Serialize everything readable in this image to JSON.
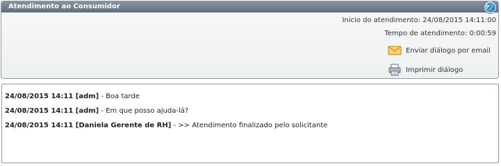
{
  "window": {
    "title": "Atendimento ao Consumidor",
    "globe_icon": "globe-icon"
  },
  "info": {
    "start_label": "Inicio do atendimento:",
    "start_value": "24/08/2015 14:11:00",
    "duration_label": "Tempo de atendimento:",
    "duration_value": "0:00:59"
  },
  "actions": {
    "email_label": "Enviar diálogo por email",
    "email_icon": "envelope-icon",
    "print_label": "Imprimir diálogo",
    "print_icon": "printer-icon"
  },
  "messages": [
    {
      "header": "24/08/2015 14:11 [adm]",
      "text": " - Boa tarde"
    },
    {
      "header": "24/08/2015 14:11 [adm]",
      "text": " - Em que posso ajuda-lá?"
    },
    {
      "header": "24/08/2015 14:11 [Daniela Gerente de RH]",
      "text": " - >> Atendimento finalizado pelo solicitante"
    }
  ],
  "colors": {
    "title_bar": "#707b89",
    "envelope": "#f2c94c"
  }
}
